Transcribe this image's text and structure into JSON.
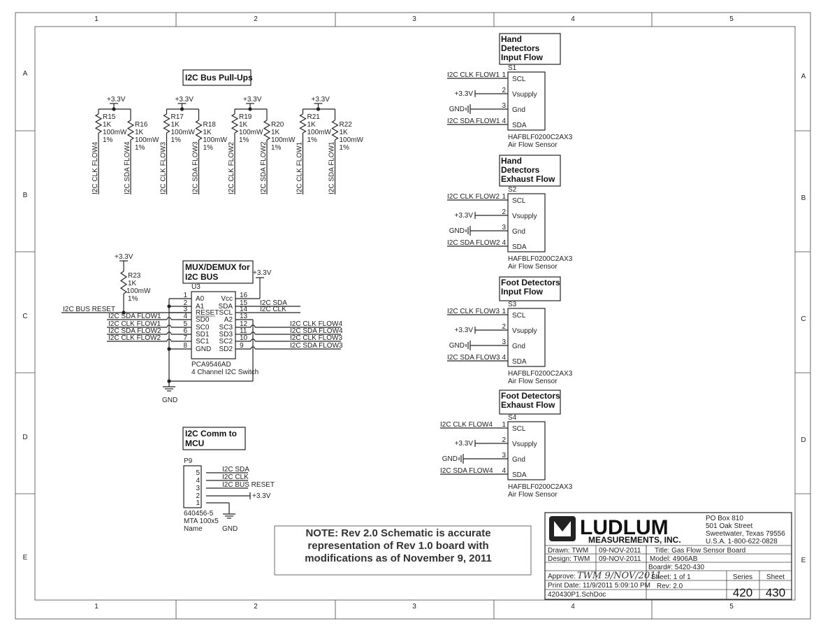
{
  "frame": {
    "columns": [
      "1",
      "2",
      "3",
      "4",
      "5"
    ],
    "rows": [
      "A",
      "B",
      "C",
      "D",
      "E"
    ]
  },
  "pullups": {
    "title": "I2C Bus Pull-Ups",
    "groups": [
      {
        "supply": "+3.3V",
        "left": {
          "ref": "R15",
          "value": "1K",
          "power": "100mW",
          "tol": "1%",
          "net": "I2C CLK FLOW4"
        },
        "right": {
          "ref": "R16",
          "value": "1K",
          "power": "100mW",
          "tol": "1%",
          "net": "I2C SDA FLOW4"
        }
      },
      {
        "supply": "+3.3V",
        "left": {
          "ref": "R17",
          "value": "1K",
          "power": "100mW",
          "tol": "1%",
          "net": "I2C CLK FLOW3"
        },
        "right": {
          "ref": "R18",
          "value": "1K",
          "power": "100mW",
          "tol": "1%",
          "net": "I2C SDA FLOW3"
        }
      },
      {
        "supply": "+3.3V",
        "left": {
          "ref": "R19",
          "value": "1K",
          "power": "100mW",
          "tol": "1%",
          "net": "I2C CLK FLOW2"
        },
        "right": {
          "ref": "R20",
          "value": "1K",
          "power": "100mW",
          "tol": "1%",
          "net": "I2C SDA FLOW2"
        }
      },
      {
        "supply": "+3.3V",
        "left": {
          "ref": "R21",
          "value": "1K",
          "power": "100mW",
          "tol": "1%",
          "net": "I2C CLK FLOW1"
        },
        "right": {
          "ref": "R22",
          "value": "1K",
          "power": "100mW",
          "tol": "1%",
          "net": "I2C SDA FLOW1"
        }
      }
    ]
  },
  "mux": {
    "title_lines": [
      "MUX/DEMUX for",
      "I2C BUS"
    ],
    "ref": "U3",
    "part": "PCA9546AD",
    "desc": "4 Channel I2C Switch",
    "supply": "+3.3V",
    "gnd": "GND",
    "r23": {
      "supply": "+3.3V",
      "ref": "R23",
      "value": "1K",
      "power": "100mW",
      "tol": "1%"
    },
    "reset_net": "I2C BUS RESET",
    "left_pins": [
      {
        "num": "1",
        "name": "A0",
        "net": ""
      },
      {
        "num": "2",
        "name": "A1",
        "net": ""
      },
      {
        "num": "3",
        "name": "RESET",
        "net": ""
      },
      {
        "num": "4",
        "name": "SD0",
        "net": "I2C SDA FLOW1"
      },
      {
        "num": "5",
        "name": "SC0",
        "net": "I2C CLK FLOW1"
      },
      {
        "num": "6",
        "name": "SD1",
        "net": "I2C SDA FLOW2"
      },
      {
        "num": "7",
        "name": "SC1",
        "net": "I2C CLK FLOW2"
      },
      {
        "num": "8",
        "name": "GND",
        "net": ""
      }
    ],
    "right_pins": [
      {
        "num": "16",
        "name": "Vcc",
        "net": ""
      },
      {
        "num": "15",
        "name": "SDA",
        "net": "I2C SDA"
      },
      {
        "num": "14",
        "name": "SCL",
        "net": "I2C CLK"
      },
      {
        "num": "13",
        "name": "A2",
        "net": ""
      },
      {
        "num": "12",
        "name": "SC3",
        "net": "I2C CLK FLOW4"
      },
      {
        "num": "11",
        "name": "SD3",
        "net": "I2C SDA FLOW4"
      },
      {
        "num": "10",
        "name": "SC2",
        "net": "I2C CLK FLOW3"
      },
      {
        "num": "9",
        "name": "SD2",
        "net": "I2C SDA FLOW3"
      }
    ]
  },
  "connector": {
    "title_lines": [
      "I2C Comm to",
      "MCU"
    ],
    "ref": "P9",
    "part": "640456-5",
    "desc": "MTA 100x5",
    "name_label": "Name",
    "pins": [
      {
        "num": "5",
        "net": "I2C SDA"
      },
      {
        "num": "4",
        "net": "I2C CLK"
      },
      {
        "num": "3",
        "net": "I2C BUS RESET"
      },
      {
        "num": "2",
        "net": "+3.3V"
      },
      {
        "num": "1",
        "net": "GND"
      }
    ]
  },
  "sensors": [
    {
      "title_lines": [
        "Hand",
        "Detectors",
        "Input Flow"
      ],
      "ref": "S1",
      "clk": "I2C CLK FLOW1",
      "sda": "I2C SDA FLOW1",
      "supply": "+3.3V",
      "gnd": "GND",
      "pins": [
        "SCL",
        "Vsupply",
        "Gnd",
        "SDA"
      ],
      "part": "HAFBLF0200C2AX3",
      "desc": "Air Flow Sensor"
    },
    {
      "title_lines": [
        "Hand",
        "Detectors",
        "Exhaust Flow"
      ],
      "ref": "S2",
      "clk": "I2C CLK FLOW2",
      "sda": "I2C SDA FLOW2",
      "supply": "+3.3V",
      "gnd": "GND",
      "pins": [
        "SCL",
        "Vsupply",
        "Gnd",
        "SDA"
      ],
      "part": "HAFBLF0200C2AX3",
      "desc": "Air Flow Sensor"
    },
    {
      "title_lines": [
        "Foot Detectors",
        "Input Flow"
      ],
      "ref": "S3",
      "clk": "I2C CLK FLOW3",
      "sda": "I2C SDA FLOW3",
      "supply": "+3.3V",
      "gnd": "GND",
      "pins": [
        "SCL",
        "Vsupply",
        "Gnd",
        "SDA"
      ],
      "part": "HAFBLF0200C2AX3",
      "desc": "Air Flow Sensor"
    },
    {
      "title_lines": [
        "Foot Detectors",
        "Exhaust Flow"
      ],
      "ref": "S4",
      "clk": "I2C CLK FLOW4",
      "sda": "I2C SDA FLOW4",
      "supply": "+3.3V",
      "gnd": "GND",
      "pins": [
        "SCL",
        "Vsupply",
        "Gnd",
        "SDA"
      ],
      "part": "HAFBLF0200C2AX3",
      "desc": "Air Flow Sensor"
    }
  ],
  "note": [
    "NOTE:  Rev 2.0 Schematic is accurate",
    "representation of Rev 1.0 board with",
    "modifications as of November 9, 2011"
  ],
  "title_block": {
    "company": "LUDLUM",
    "company_sub": "MEASUREMENTS, INC.",
    "address": [
      "PO Box 810",
      "501 Oak Street",
      "Sweetwater, Texas  79556",
      "U.S.A.  1-800-622-0828"
    ],
    "drawn": "Drawn:  TWM",
    "drawn_date": "09-NOV-2011",
    "design": "Design:  TWM",
    "design_date": "09-NOV-2011",
    "title": "Title:  Gas Flow Sensor Board",
    "model": "Model:  4906AB",
    "board": "Board#:  5420-430",
    "approve": "Approve:",
    "approve_sig": "TWM  9/NOV/2011",
    "sheet": "Sheet:  1    of  1",
    "print_date": "Print Date:  11/9/2011  5:09:10 PM",
    "rev": "Rev:  2.0",
    "filename": "420430P1.SchDoc",
    "series_label": "Series",
    "series": "420",
    "sheet_label": "Sheet",
    "sheet_no": "430"
  }
}
